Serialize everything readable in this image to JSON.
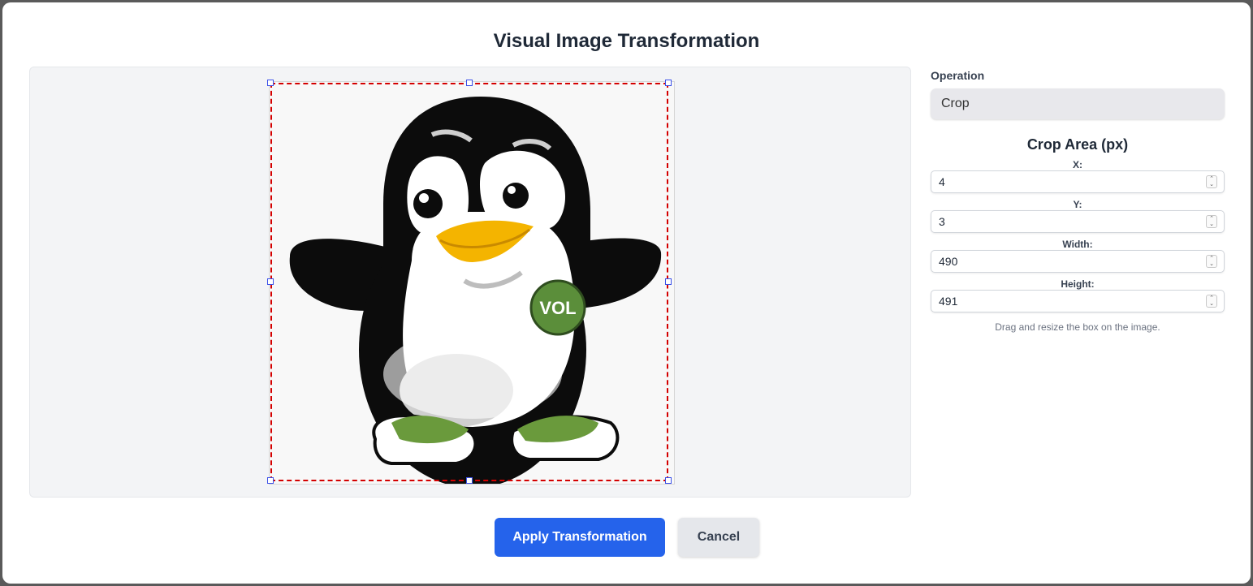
{
  "dialog": {
    "title": "Visual Image Transformation"
  },
  "preview": {
    "badge_text": "VOL"
  },
  "crop": {
    "x": 4,
    "y": 3,
    "width": 490,
    "height": 491
  },
  "panel": {
    "operation_label": "Operation",
    "operation_value": "Crop",
    "crop_heading": "Crop Area (px)",
    "x_label": "X:",
    "x_value": "4",
    "y_label": "Y:",
    "y_value": "3",
    "width_label": "Width:",
    "width_value": "490",
    "height_label": "Height:",
    "height_value": "491",
    "hint": "Drag and resize the box on the image."
  },
  "buttons": {
    "apply": "Apply Transformation",
    "cancel": "Cancel"
  },
  "colors": {
    "primary": "#2563eb",
    "crop_border": "#d40000",
    "handle_border": "#3b50e8"
  }
}
